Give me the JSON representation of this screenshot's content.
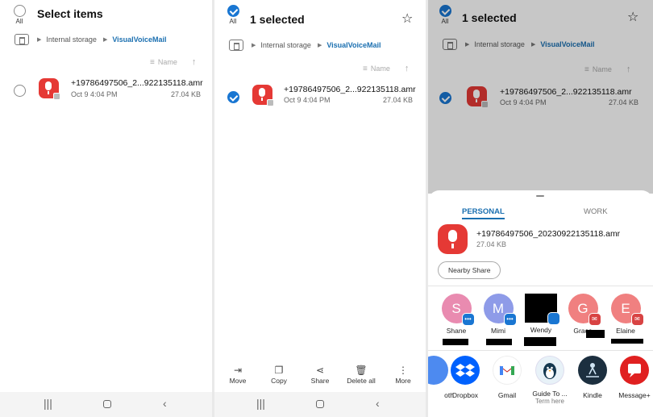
{
  "panel1": {
    "all_label": "All",
    "title": "Select items",
    "breadcrumb": {
      "root": "Internal storage",
      "current": "VisualVoiceMail"
    },
    "sort_label": "Name",
    "file": {
      "name": "+19786497506_2...922135118.amr",
      "date": "Oct 9 4:04 PM",
      "size": "27.04 KB"
    }
  },
  "panel2": {
    "all_label": "All",
    "title": "1 selected",
    "breadcrumb": {
      "root": "Internal storage",
      "current": "VisualVoiceMail"
    },
    "sort_label": "Name",
    "file": {
      "name": "+19786497506_2...922135118.amr",
      "date": "Oct 9 4:04 PM",
      "size": "27.04 KB"
    },
    "actions": [
      {
        "label": "Move",
        "icon": "move-icon"
      },
      {
        "label": "Copy",
        "icon": "copy-icon"
      },
      {
        "label": "Share",
        "icon": "share-icon"
      },
      {
        "label": "Delete all",
        "icon": "trash-icon"
      },
      {
        "label": "More",
        "icon": "more-icon"
      }
    ]
  },
  "panel3": {
    "all_label": "All",
    "title": "1 selected",
    "breadcrumb": {
      "root": "Internal storage",
      "current": "VisualVoiceMail"
    },
    "sort_label": "Name",
    "file": {
      "name": "+19786497506_2...922135118.amr",
      "date": "Oct 9 4:04 PM",
      "size": "27.04 KB"
    },
    "share_sheet": {
      "tabs": [
        "PERSONAL",
        "WORK"
      ],
      "file_name": "+19786497506_20230922135118.amr",
      "file_size": "27.04 KB",
      "nearby_share": "Nearby Share",
      "contacts": [
        {
          "name": "Shane",
          "initial": "S",
          "color": "#e98bb0",
          "badge": "message-icon"
        },
        {
          "name": "Mimi",
          "initial": "M",
          "color": "#8e9be8",
          "badge": "message-icon"
        },
        {
          "name": "Wendy",
          "initial": "",
          "color": "#000000",
          "badge": "message-icon"
        },
        {
          "name": "Grace",
          "initial": "G",
          "color": "#f08080",
          "badge": "mail-icon"
        },
        {
          "name": "Elaine",
          "initial": "E",
          "color": "#f08080",
          "badge": "mail-icon"
        }
      ],
      "apps": [
        {
          "label": "oth",
          "sub": "",
          "icon": "bluetooth-icon"
        },
        {
          "label": "Dropbox",
          "sub": "",
          "icon": "dropbox-icon"
        },
        {
          "label": "Gmail",
          "sub": "",
          "icon": "gmail-icon"
        },
        {
          "label": "Guide To ...",
          "sub": "Term here",
          "icon": "guide-app-icon"
        },
        {
          "label": "Kindle",
          "sub": "",
          "icon": "kindle-icon"
        },
        {
          "label": "Message+",
          "sub": "",
          "icon": "message-plus-icon"
        }
      ]
    }
  }
}
